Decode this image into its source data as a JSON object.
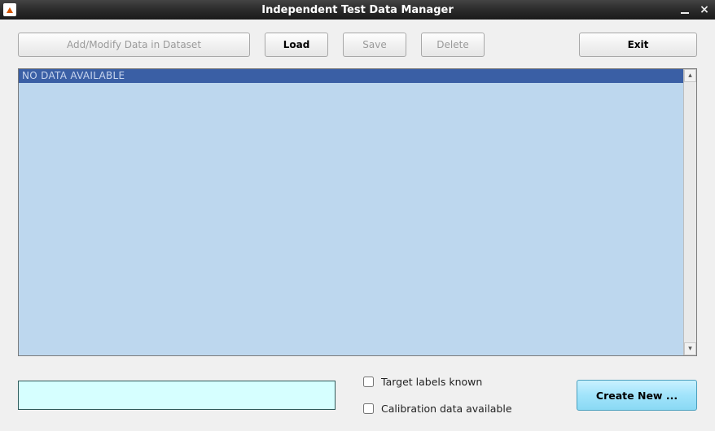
{
  "window": {
    "title": "Independent Test Data Manager"
  },
  "toolbar": {
    "add_modify": "Add/Modify Data in Dataset",
    "load": "Load",
    "save": "Save",
    "delete": "Delete",
    "exit": "Exit"
  },
  "list": {
    "empty_message": "NO DATA AVAILABLE"
  },
  "bottom": {
    "name_value": "",
    "target_labels_label": "Target labels known",
    "calibration_label": "Calibration data available",
    "create_label": "Create New ...",
    "target_labels_checked": false,
    "calibration_checked": false
  }
}
